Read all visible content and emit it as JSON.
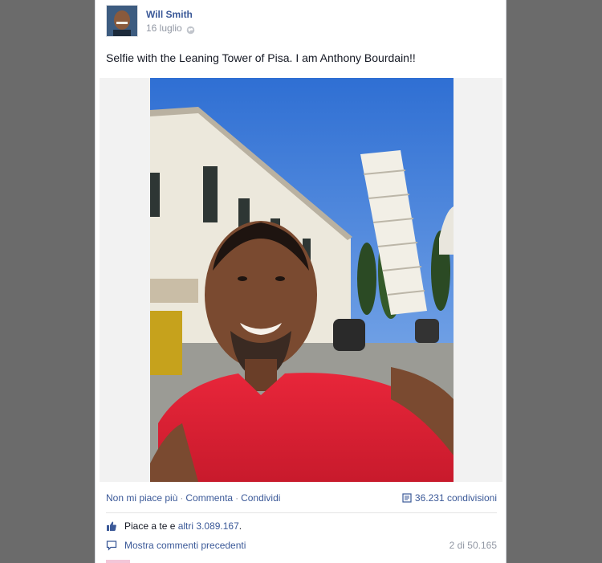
{
  "post": {
    "author": "Will Smith",
    "date": "16 luglio",
    "text": "Selfie with the Leaning Tower of Pisa. I am Anthony Bourdain!!",
    "privacy_icon": "globe-icon"
  },
  "actions": {
    "unlike": "Non mi piace più",
    "comment": "Commenta",
    "share": "Condividi",
    "separator": "·",
    "shares_count": "36.231 condivisioni"
  },
  "likes": {
    "prefix": "Piace a te e ",
    "others_link": "altri 3.089.167",
    "suffix": "."
  },
  "comments": {
    "show_previous": "Mostra commenti precedenti",
    "count": "2 di 50.165"
  },
  "colors": {
    "link": "#3b5998",
    "muted": "#9197a3",
    "page_background": "#6b6b6b"
  }
}
